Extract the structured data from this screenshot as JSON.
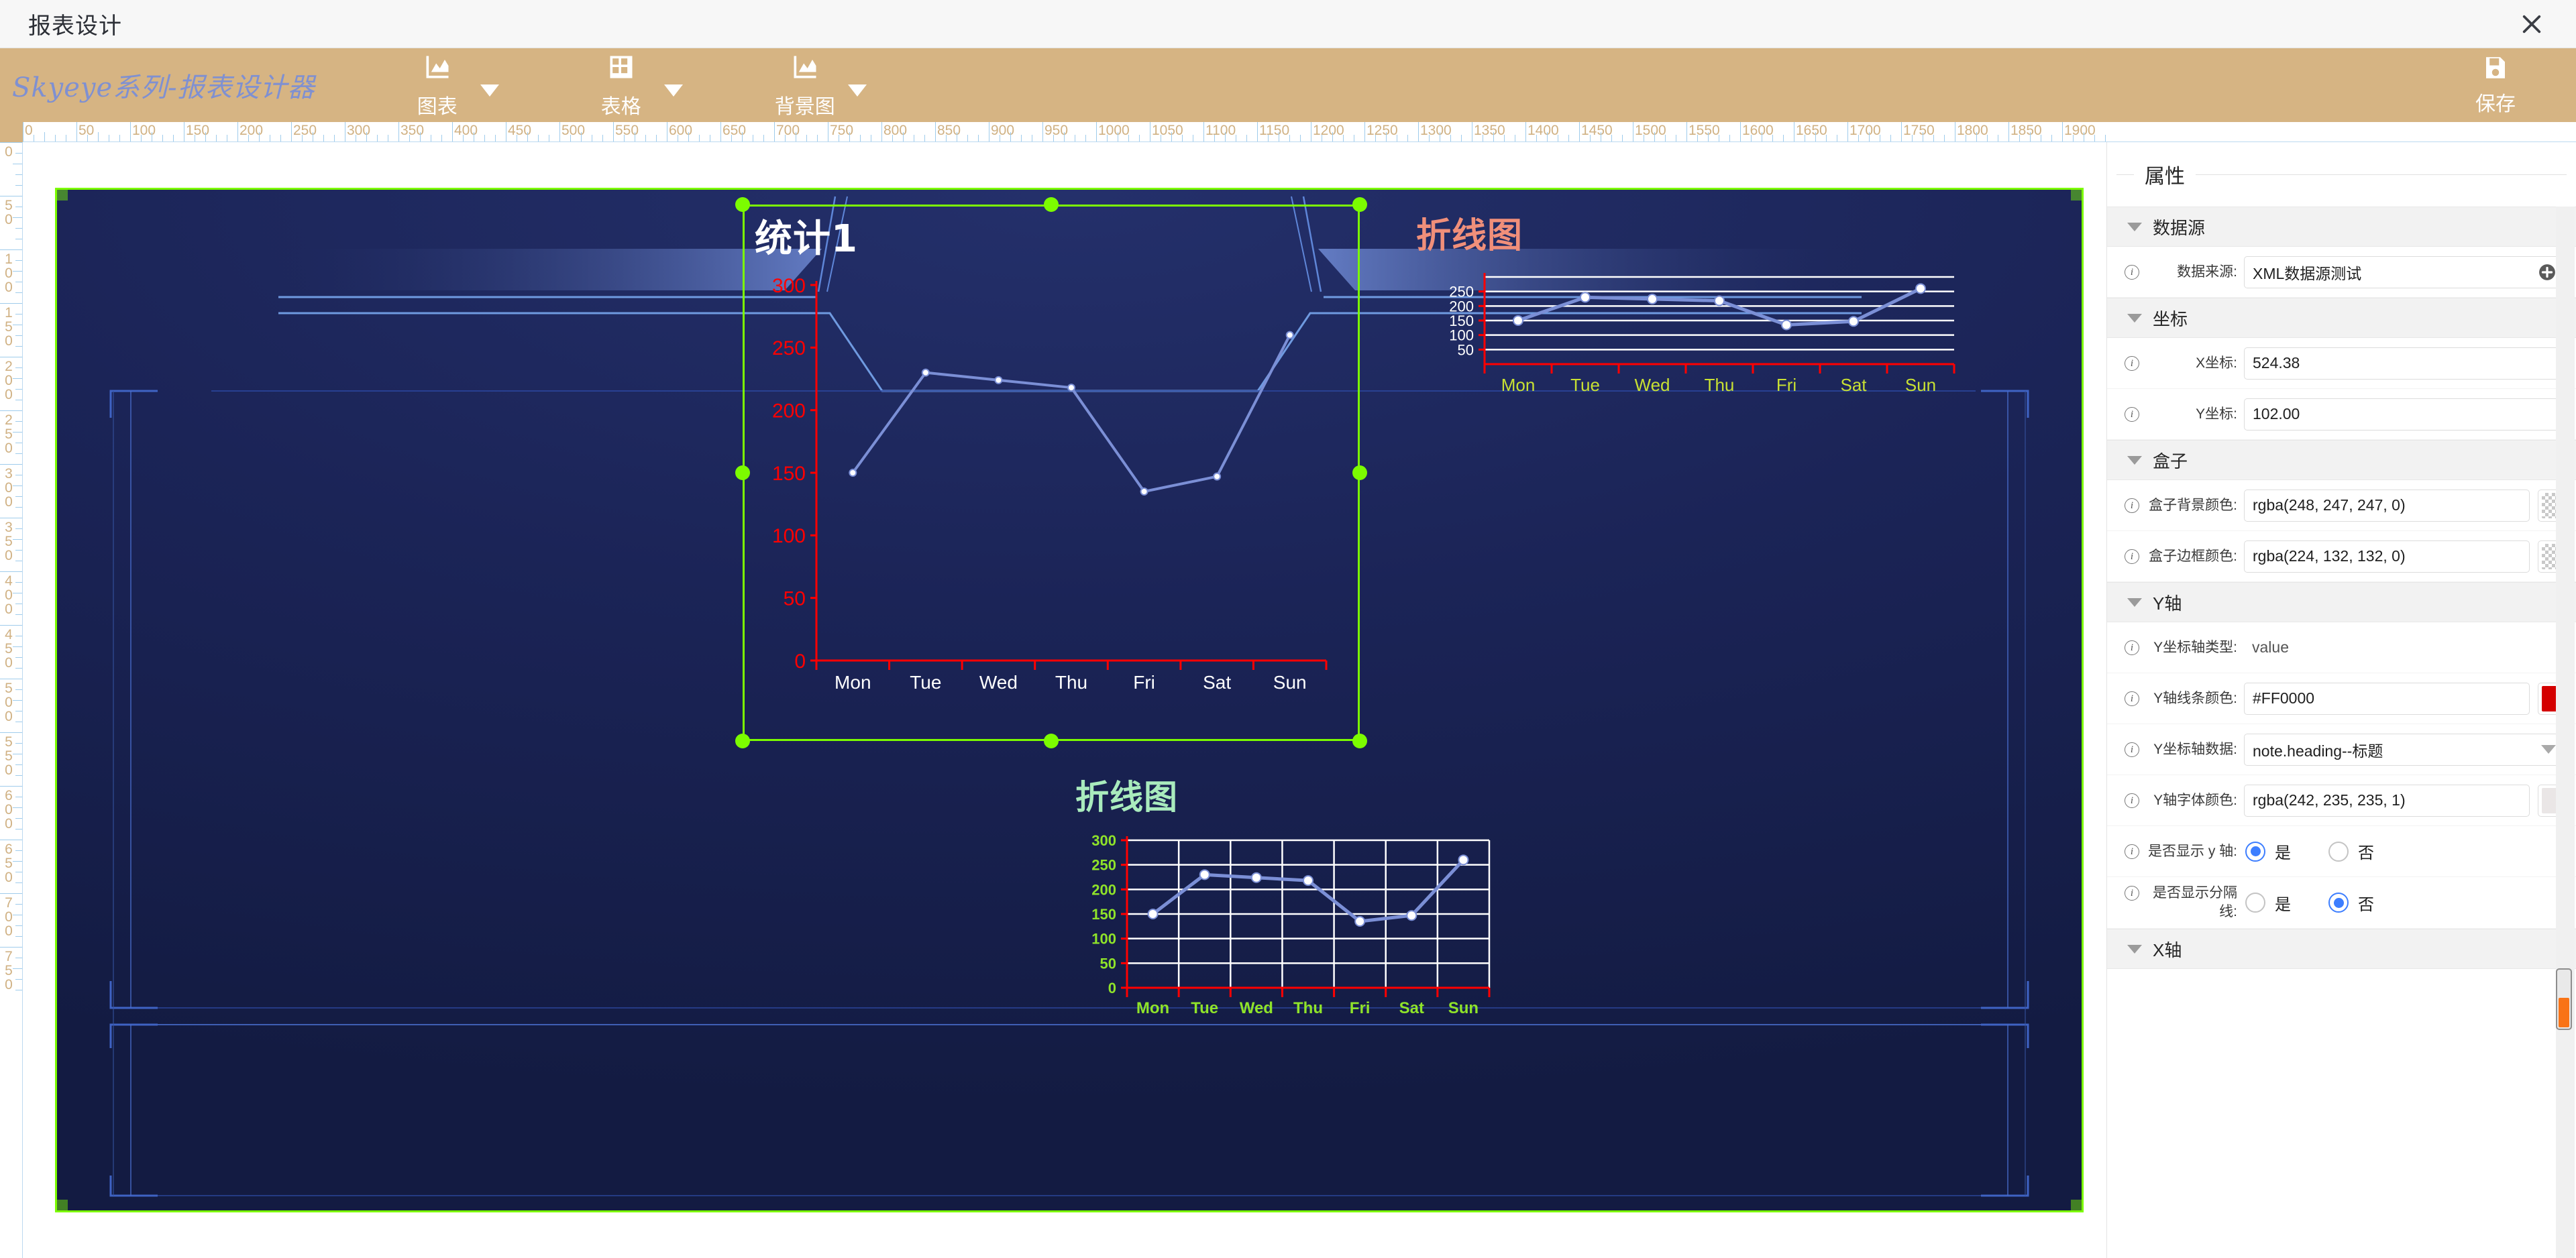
{
  "window": {
    "title": "报表设计",
    "close_icon": "close-icon"
  },
  "toolbar": {
    "brand": "Skyeye系列-报表设计器",
    "items": [
      {
        "label": "图表",
        "icon": "chart-icon"
      },
      {
        "label": "表格",
        "icon": "table-grid-icon"
      },
      {
        "label": "背景图",
        "icon": "background-image-icon"
      }
    ],
    "save_label": "保存",
    "save_icon": "floppy-save-icon"
  },
  "ruler": {
    "horizontal_labels": [
      0,
      50,
      100,
      150,
      200,
      250,
      300,
      350,
      400,
      450,
      500,
      550,
      600,
      650,
      700,
      750,
      800,
      850,
      900,
      950,
      1000,
      1050,
      1100,
      1150,
      1200,
      1250,
      1300,
      1350,
      1400,
      1450,
      1500,
      1550,
      1600,
      1650,
      1700,
      1750,
      1800,
      1850,
      1900
    ],
    "vertical_labels": [
      0,
      50,
      100,
      150,
      200,
      250,
      300,
      350,
      400,
      450,
      500,
      550,
      600,
      650,
      700,
      750
    ],
    "unit_step": 50
  },
  "canvas": {
    "background_color": "#1b2457",
    "selection_color": "#7cfc00"
  },
  "charts": [
    {
      "id": "chart-main",
      "title": "统计1",
      "title_color": "#ffffff",
      "selected": true,
      "style": "plain-axis",
      "chart_data": {
        "type": "line",
        "title": "统计1",
        "categories": [
          "Mon",
          "Tue",
          "Wed",
          "Thu",
          "Fri",
          "Sat",
          "Sun"
        ],
        "series": [
          {
            "name": "统计1",
            "values": [
              150,
              230,
              224,
              218,
              135,
              147,
              260
            ]
          }
        ],
        "ylim": [
          0,
          300
        ],
        "yticks": [
          0,
          50,
          100,
          150,
          200,
          250,
          300
        ],
        "xlabel": "",
        "ylabel": "",
        "grid": false,
        "axis_line_color": "#FF0000",
        "ytick_label_color": "#FF0000",
        "xtick_label_color": "#ffffff",
        "line_color": "#7b8fd6",
        "legend": "none"
      }
    },
    {
      "id": "chart-top-right",
      "title": "折线图",
      "title_color": "#f08f7a",
      "selected": false,
      "style": "h-gridlines",
      "chart_data": {
        "type": "line",
        "title": "折线图",
        "categories": [
          "Mon",
          "Tue",
          "Wed",
          "Thu",
          "Fri",
          "Sat",
          "Sun"
        ],
        "series": [
          {
            "name": "折线图",
            "values": [
              150,
              230,
              224,
              218,
              135,
              147,
              260
            ]
          }
        ],
        "ylim": [
          0,
          300
        ],
        "yticks": [
          50,
          100,
          150,
          200,
          250
        ],
        "xlabel": "",
        "ylabel": "",
        "grid": true,
        "grid_axis": "y",
        "grid_color": "#ffffff",
        "axis_line_color": "#FF0000",
        "ytick_label_color": "#ffffff",
        "xtick_label_color": "#c8e033",
        "line_color": "#7b8fd6",
        "legend": "none"
      }
    },
    {
      "id": "chart-bottom",
      "title": "折线图",
      "title_color": "#a9ebbd",
      "selected": false,
      "style": "full-grid",
      "chart_data": {
        "type": "line",
        "title": "折线图",
        "categories": [
          "Mon",
          "Tue",
          "Wed",
          "Thu",
          "Fri",
          "Sat",
          "Sun"
        ],
        "series": [
          {
            "name": "折线图",
            "values": [
              150,
              230,
              224,
              218,
              135,
              147,
              260
            ]
          }
        ],
        "ylim": [
          0,
          300
        ],
        "yticks": [
          0,
          50,
          100,
          150,
          200,
          250,
          300
        ],
        "xlabel": "",
        "ylabel": "",
        "grid": true,
        "grid_axis": "both",
        "grid_color": "#ffffff",
        "axis_line_color": "#FF0000",
        "ytick_label_color": "#8fe32a",
        "xtick_label_color": "#8fe32a",
        "line_color": "#7b8fd6",
        "legend": "none"
      }
    }
  ],
  "properties": {
    "header": "属性",
    "sections": [
      {
        "name": "datasource",
        "title": "数据源",
        "rows": [
          {
            "name": "data-source",
            "label": "数据来源:",
            "type": "text-plus",
            "value": "XML数据源测试"
          }
        ]
      },
      {
        "name": "coordinates",
        "title": "坐标",
        "rows": [
          {
            "name": "x-coordinate",
            "label": "X坐标:",
            "type": "text",
            "value": "524.38"
          },
          {
            "name": "y-coordinate",
            "label": "Y坐标:",
            "type": "text",
            "value": "102.00"
          }
        ]
      },
      {
        "name": "box",
        "title": "盒子",
        "rows": [
          {
            "name": "box-background-color",
            "label": "盒子背景颜色:",
            "type": "color",
            "value": "rgba(248, 247, 247, 0)",
            "swatch": "transparent"
          },
          {
            "name": "box-border-color",
            "label": "盒子边框颜色:",
            "type": "color",
            "value": "rgba(224, 132, 132, 0)",
            "swatch": "transparent"
          }
        ]
      },
      {
        "name": "y-axis",
        "title": "Y轴",
        "rows": [
          {
            "name": "y-axis-type",
            "label": "Y坐标轴类型:",
            "type": "static",
            "value": "value"
          },
          {
            "name": "y-axis-line-color",
            "label": "Y轴线条颜色:",
            "type": "color",
            "value": "#FF0000",
            "swatch": "#d40000"
          },
          {
            "name": "y-axis-data",
            "label": "Y坐标轴数据:",
            "type": "select",
            "value": "note.heading--标题"
          },
          {
            "name": "y-axis-font-color",
            "label": "Y轴字体颜色:",
            "type": "color",
            "value": "rgba(242, 235, 235, 1)",
            "swatch": "#eae6e6"
          },
          {
            "name": "show-y-axis",
            "label": "是否显示 y 轴:",
            "type": "radio",
            "options": [
              "是",
              "否"
            ],
            "selected": 0
          },
          {
            "name": "show-split-line",
            "label": "是否显示分隔线:",
            "type": "radio",
            "options": [
              "是",
              "否"
            ],
            "selected": 1
          }
        ]
      },
      {
        "name": "x-axis",
        "title": "X轴",
        "rows": []
      }
    ]
  }
}
